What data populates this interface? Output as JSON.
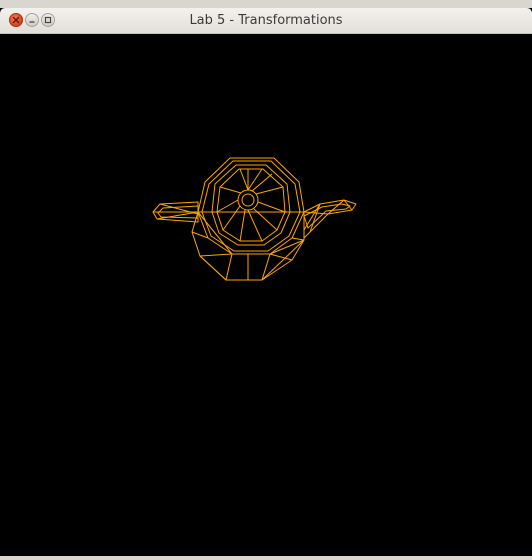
{
  "window": {
    "title": "Lab 5 - Transformations",
    "controls": {
      "close": "close-icon",
      "minimize": "minimize-icon",
      "maximize": "maximize-icon"
    }
  },
  "viewport": {
    "background_color": "#000000",
    "wireframe_color": "#ffa500",
    "model": "teapot-wireframe"
  }
}
